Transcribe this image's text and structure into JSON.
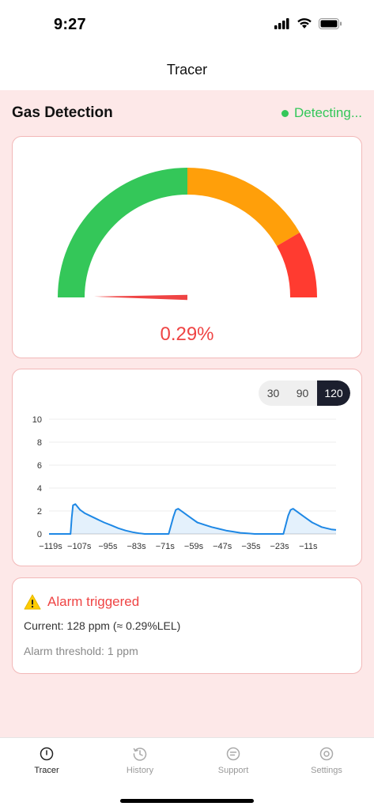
{
  "status_bar": {
    "time": "9:27"
  },
  "nav": {
    "title": "Tracer"
  },
  "detection": {
    "title": "Gas Detection",
    "status": "Detecting..."
  },
  "gauge": {
    "value_text": "0.29%",
    "value_percent": 0.29,
    "max": 100
  },
  "chart_data": {
    "type": "area",
    "ylim": [
      0,
      10
    ],
    "yticks": [
      "10",
      "8",
      "6",
      "4",
      "2",
      "0"
    ],
    "xlim": [
      -120,
      0
    ],
    "xticks": [
      "−119s",
      "−107s",
      "−95s",
      "−83s",
      "−71s",
      "−59s",
      "−47s",
      "−35s",
      "−23s",
      "−11s"
    ],
    "series": [
      {
        "x": [
          -120,
          -111,
          -110.5,
          -110,
          -109,
          -107,
          -105,
          -103,
          -100,
          -97,
          -94,
          -91,
          -88,
          -85,
          -82,
          -80,
          -70,
          -68,
          -67,
          -66,
          -64,
          -62,
          -60,
          -58,
          -55,
          -52,
          -49,
          -46,
          -43,
          -40,
          -37,
          -34,
          -30,
          -22,
          -20,
          -19,
          -18,
          -16,
          -14,
          -12,
          -10,
          -8,
          -6,
          -4,
          -2,
          0
        ],
        "y": [
          0,
          0,
          1.4,
          2.5,
          2.6,
          2.1,
          1.8,
          1.6,
          1.3,
          1.0,
          0.75,
          0.5,
          0.3,
          0.15,
          0.05,
          0,
          0,
          1.5,
          2.1,
          2.2,
          1.9,
          1.6,
          1.3,
          1.0,
          0.8,
          0.6,
          0.45,
          0.3,
          0.2,
          0.1,
          0.05,
          0,
          0,
          0,
          1.6,
          2.1,
          2.2,
          1.9,
          1.6,
          1.3,
          1.0,
          0.8,
          0.6,
          0.5,
          0.4,
          0.35
        ]
      }
    ]
  },
  "ranges": {
    "options": [
      "30",
      "90",
      "120"
    ],
    "selected": "120"
  },
  "alarm": {
    "title": "Alarm triggered",
    "current": "Current: 128 ppm (≈ 0.29%LEL)",
    "threshold": "Alarm threshold: 1 ppm"
  },
  "tabs": [
    {
      "label": "Tracer",
      "icon": "gauge-icon"
    },
    {
      "label": "History",
      "icon": "history-icon"
    },
    {
      "label": "Support",
      "icon": "support-icon"
    },
    {
      "label": "Settings",
      "icon": "settings-icon"
    }
  ],
  "colors": {
    "green": "#34c759",
    "orange": "#ff9f0a",
    "red": "#ff3b30",
    "line": "#1e88e5"
  }
}
